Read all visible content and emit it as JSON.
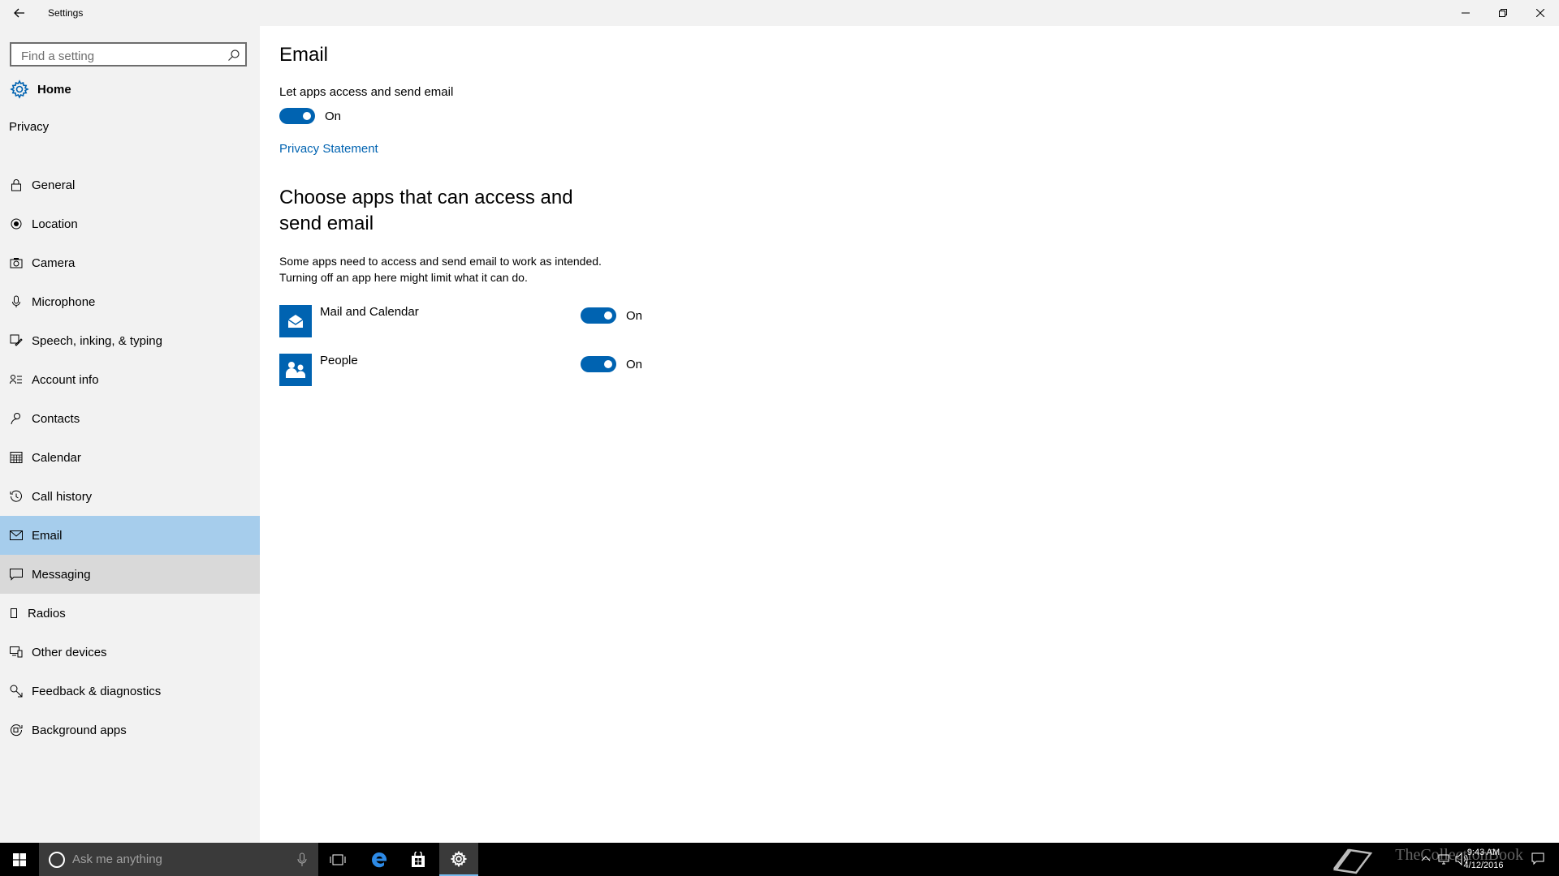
{
  "window": {
    "title": "Settings"
  },
  "sidebar": {
    "search_placeholder": "Find a setting",
    "home_label": "Home",
    "section": "Privacy",
    "items": [
      {
        "label": "General",
        "icon": "lock-icon"
      },
      {
        "label": "Location",
        "icon": "location-icon"
      },
      {
        "label": "Camera",
        "icon": "camera-icon"
      },
      {
        "label": "Microphone",
        "icon": "microphone-icon"
      },
      {
        "label": "Speech, inking, & typing",
        "icon": "speech-icon"
      },
      {
        "label": "Account info",
        "icon": "account-info-icon"
      },
      {
        "label": "Contacts",
        "icon": "contacts-icon"
      },
      {
        "label": "Calendar",
        "icon": "calendar-icon"
      },
      {
        "label": "Call history",
        "icon": "history-icon"
      },
      {
        "label": "Email",
        "icon": "mail-icon"
      },
      {
        "label": "Messaging",
        "icon": "message-icon"
      },
      {
        "label": "Radios",
        "icon": "radio-icon"
      },
      {
        "label": "Other devices",
        "icon": "devices-icon"
      },
      {
        "label": "Feedback & diagnostics",
        "icon": "feedback-icon"
      },
      {
        "label": "Background apps",
        "icon": "background-apps-icon"
      }
    ],
    "selected": "Email",
    "hovered": "Messaging"
  },
  "main": {
    "title": "Email",
    "master_toggle": {
      "label": "Let apps access and send email",
      "state": "On"
    },
    "privacy_link": "Privacy Statement",
    "apps_heading": "Choose apps that can access and send email",
    "apps_description_line1": "Some apps need to access and send email to work as intended.",
    "apps_description_line2": "Turning off an app here might limit what it can do.",
    "apps": [
      {
        "name": "Mail and Calendar",
        "state": "On",
        "icon": "mail-calendar-icon"
      },
      {
        "name": "People",
        "state": "On",
        "icon": "people-icon"
      }
    ]
  },
  "taskbar": {
    "search_placeholder": "Ask me anything",
    "clock_time": "9:43 AM",
    "clock_date": "4/12/2016",
    "watermark": "TheCollectionBook"
  },
  "colors": {
    "accent": "#0063b1",
    "selected_nav": "#a6cdec",
    "sidebar_bg": "#f2f2f2",
    "taskbar_bg": "#000000"
  }
}
